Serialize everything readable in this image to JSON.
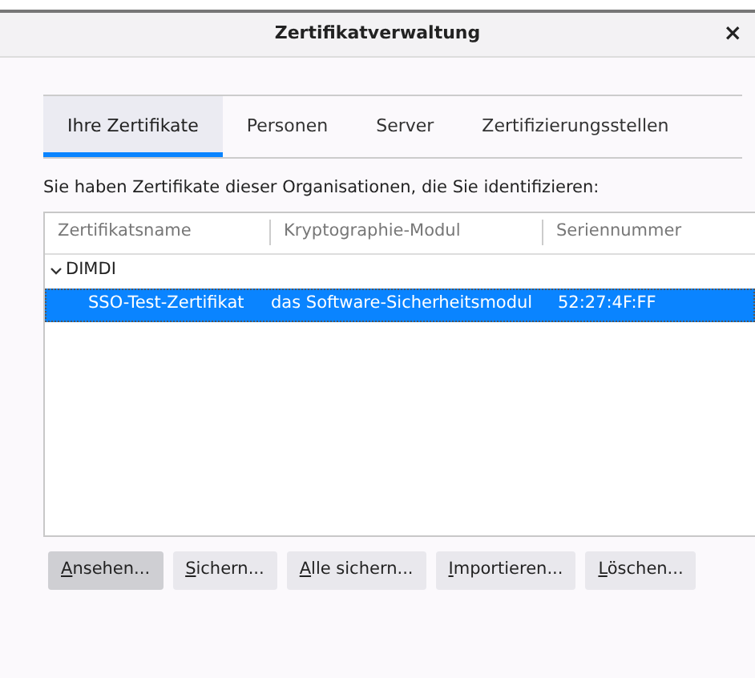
{
  "window": {
    "title": "Zertifikatverwaltung",
    "close": "×"
  },
  "tabs": [
    {
      "label": "Ihre Zertifikate",
      "selected": true
    },
    {
      "label": "Personen",
      "selected": false
    },
    {
      "label": "Server",
      "selected": false
    },
    {
      "label": "Zertifizierungsstellen",
      "selected": false
    }
  ],
  "description": "Sie haben Zertifikate dieser Organisationen, die Sie identifizieren:",
  "table": {
    "columns": [
      "Zertifikatsname",
      "Kryptographie-Modul",
      "Seriennummer"
    ],
    "groups": [
      {
        "name": "DIMDI",
        "expanded": true,
        "rows": [
          {
            "cells": [
              "SSO-Test-Zertifikat",
              "das Software-Sicherheitsmodul",
              "52:27:4F:FF"
            ],
            "selected": true
          }
        ]
      }
    ]
  },
  "buttons": [
    {
      "label": "Ansehen...",
      "focused": true
    },
    {
      "label": "Sichern...",
      "focused": false
    },
    {
      "label": "Alle sichern...",
      "focused": false
    },
    {
      "label": "Importieren...",
      "focused": false
    },
    {
      "label": "Löschen...",
      "focused": false
    }
  ]
}
